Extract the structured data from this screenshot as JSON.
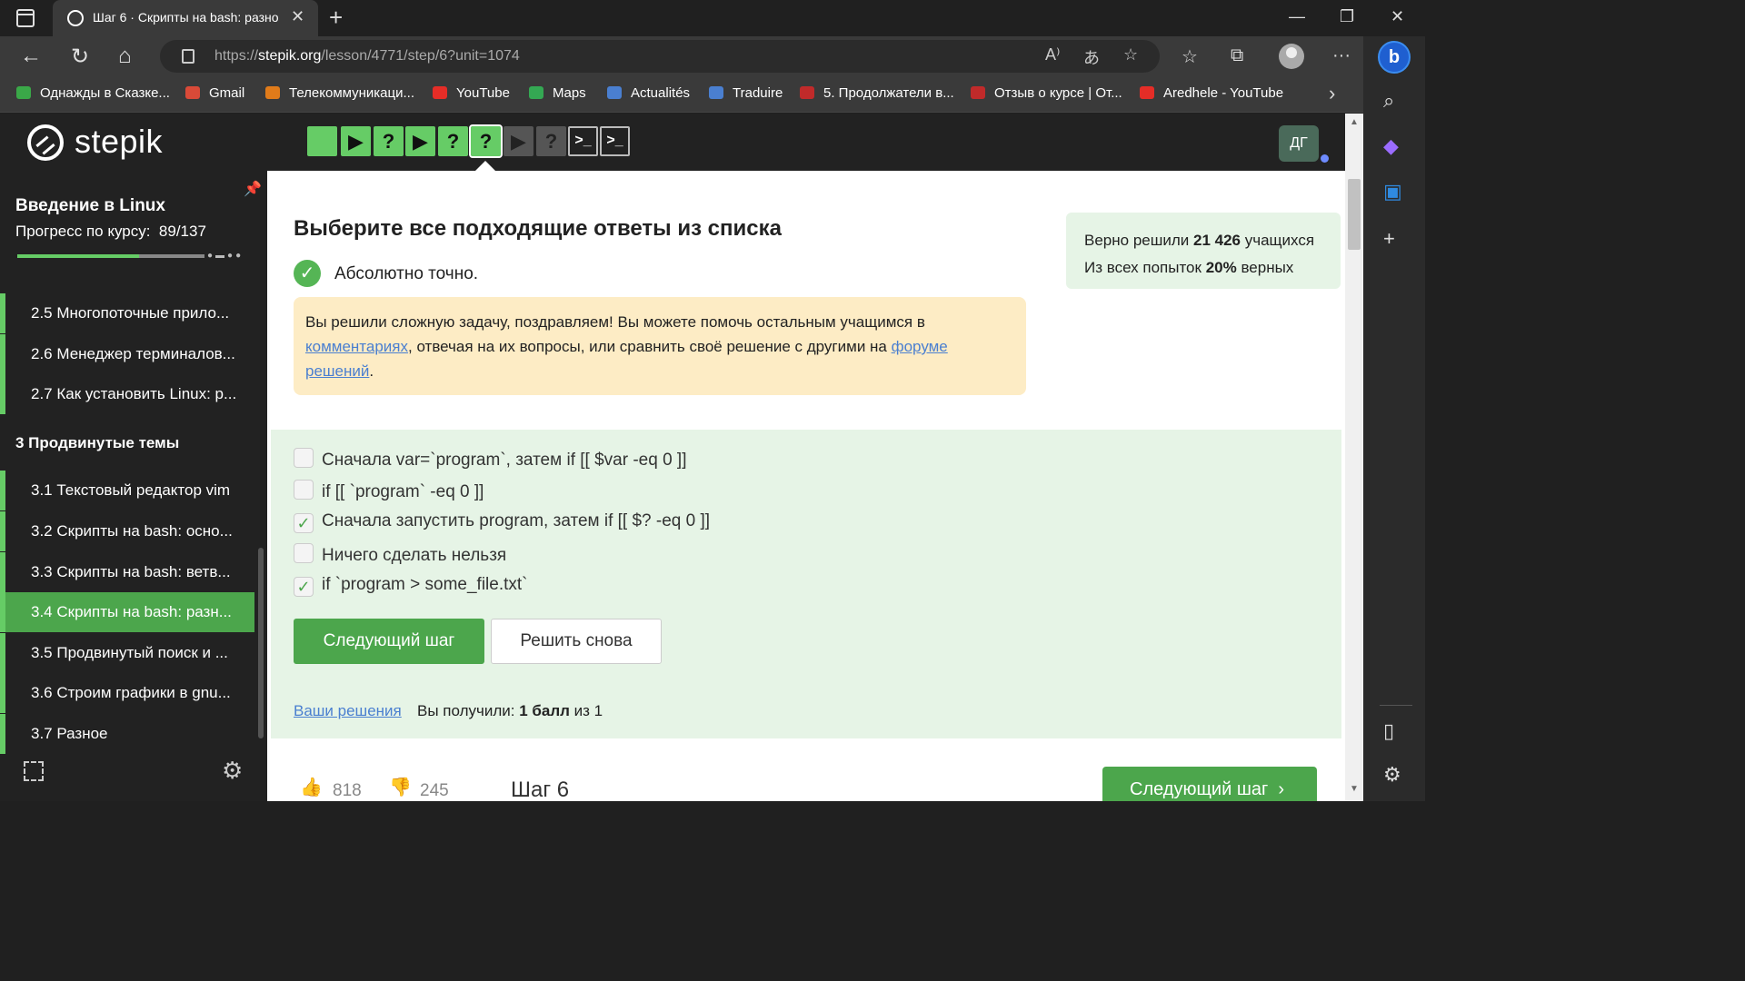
{
  "browser": {
    "tab_title": "Шаг 6 · Скрипты на bash: разно",
    "url_prefix": "https://",
    "url_host": "stepik.org",
    "url_path": "/lesson/4771/step/6?unit=1074",
    "bookmarks": [
      {
        "label": "Однажды в Сказке...",
        "icon": "hd-icon",
        "color": "#3aa848"
      },
      {
        "label": "Gmail",
        "icon": "gmail-icon",
        "color": "#d94a38"
      },
      {
        "label": "Телекоммуникаци...",
        "icon": "telecom-icon",
        "color": "#e07b1a"
      },
      {
        "label": "YouTube",
        "icon": "youtube-icon",
        "color": "#e52d27"
      },
      {
        "label": "Maps",
        "icon": "maps-icon",
        "color": "#34a853"
      },
      {
        "label": "Actualités",
        "icon": "news-icon",
        "color": "#4a7fd0"
      },
      {
        "label": "Traduire",
        "icon": "translate-icon",
        "color": "#4a7fd0"
      },
      {
        "label": "5. Продолжатели в...",
        "icon": "video-icon",
        "color": "#c02a2a"
      },
      {
        "label": "Отзыв о курсе | От...",
        "icon": "video-icon",
        "color": "#c02a2a"
      },
      {
        "label": "Aredhele - YouTube",
        "icon": "youtube-icon",
        "color": "#e52d27"
      }
    ]
  },
  "header": {
    "logo_text": "stepik",
    "avatar_initials": "ДГ",
    "steps": [
      {
        "kind": "text",
        "state": "done",
        "glyph": ""
      },
      {
        "kind": "video",
        "state": "done",
        "glyph": "▶"
      },
      {
        "kind": "quiz",
        "state": "done",
        "glyph": "?"
      },
      {
        "kind": "video",
        "state": "done",
        "glyph": "▶"
      },
      {
        "kind": "quiz",
        "state": "done",
        "glyph": "?"
      },
      {
        "kind": "quiz",
        "state": "current",
        "glyph": "?"
      },
      {
        "kind": "video",
        "state": "todo",
        "glyph": "▶"
      },
      {
        "kind": "quiz",
        "state": "todo",
        "glyph": "?"
      },
      {
        "kind": "terminal",
        "state": "todo",
        "glyph": ">_"
      },
      {
        "kind": "terminal",
        "state": "todo",
        "glyph": ">_"
      }
    ]
  },
  "sidebar": {
    "course_title": "Введение в Linux",
    "progress_label": "Прогресс по курсу:",
    "progress_value": "89/137",
    "progress_fraction": 0.65,
    "lessons_top": [
      "2.5  Многопоточные прило...",
      "2.6  Менеджер терминалов...",
      "2.7  Как установить Linux: р..."
    ],
    "section_title": "3  Продвинутые темы",
    "lessons_bottom": [
      {
        "label": "3.1  Текстовый редактор vim",
        "active": false
      },
      {
        "label": "3.2  Скрипты на bash: осно...",
        "active": false
      },
      {
        "label": "3.3  Скрипты на bash: ветв...",
        "active": false
      },
      {
        "label": "3.4  Скрипты на bash: разн...",
        "active": true
      },
      {
        "label": "3.5  Продвинутый поиск и ...",
        "active": false
      },
      {
        "label": "3.6  Строим графики в gnu...",
        "active": false
      },
      {
        "label": "3.7  Разное",
        "active": false
      }
    ]
  },
  "main": {
    "heading": "Выберите все подходящие ответы из списка",
    "correct_text": "Абсолютно точно.",
    "stats": {
      "line1_prefix": "Верно решили ",
      "line1_value": "21 426",
      "line1_suffix": " учащихся",
      "line2_prefix": "Из всех попыток ",
      "line2_value": "20%",
      "line2_suffix": " верных"
    },
    "congrats": {
      "part1": "Вы решили сложную задачу, поздравляем! Вы можете помочь остальным учащимся в ",
      "link1": "комментариях",
      "part2": ", отвечая на их вопросы, или сравнить своё решение с другими на ",
      "link2": "форуме решений",
      "part3": "."
    },
    "options": [
      {
        "text": "Сначала var=`program`, затем if [[ $var -eq 0 ]]",
        "checked": false
      },
      {
        "text": "if [[ `program` -eq 0 ]]",
        "checked": false
      },
      {
        "text": "Сначала запустить program, затем if [[ $? -eq 0 ]]",
        "checked": true
      },
      {
        "text": "Ничего сделать нельзя",
        "checked": false
      },
      {
        "text": "if `program > some_file.txt`",
        "checked": true
      }
    ],
    "next_button": "Следующий шаг",
    "retry_button": "Решить снова",
    "your_solutions": "Ваши решения",
    "score_prefix": "Вы получили: ",
    "score_value": "1 балл",
    "score_suffix": " из 1",
    "likes": "818",
    "dislikes": "245",
    "step_label": "Шаг 6",
    "next_button_bottom": "Следующий шаг"
  }
}
